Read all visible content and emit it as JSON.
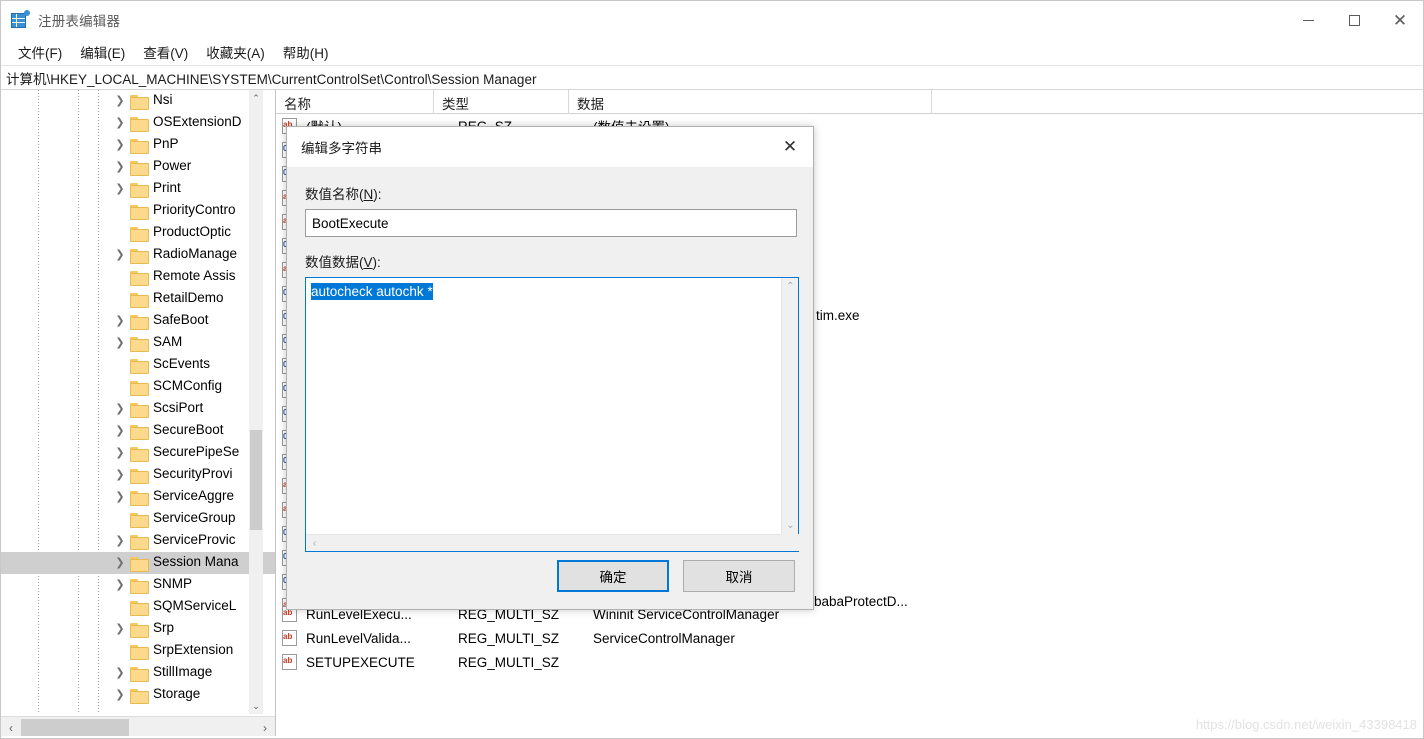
{
  "window": {
    "title": "注册表编辑器",
    "icon": "registry-editor-icon",
    "controls": {
      "minimize": "—",
      "maximize": "□",
      "close": "✕"
    }
  },
  "menubar": {
    "items": [
      {
        "label": "文件(F)",
        "name": "menu-file"
      },
      {
        "label": "编辑(E)",
        "name": "menu-edit"
      },
      {
        "label": "查看(V)",
        "name": "menu-view"
      },
      {
        "label": "收藏夹(A)",
        "name": "menu-favorites"
      },
      {
        "label": "帮助(H)",
        "name": "menu-help"
      }
    ]
  },
  "address": {
    "path": "计算机\\HKEY_LOCAL_MACHINE\\SYSTEM\\CurrentControlSet\\Control\\Session Manager"
  },
  "tree": {
    "items": [
      {
        "label": "Nsi",
        "expandable": true,
        "selected": false
      },
      {
        "label": "OSExtensionD",
        "expandable": true,
        "selected": false
      },
      {
        "label": "PnP",
        "expandable": true,
        "selected": false
      },
      {
        "label": "Power",
        "expandable": true,
        "selected": false
      },
      {
        "label": "Print",
        "expandable": true,
        "selected": false
      },
      {
        "label": "PriorityContro",
        "expandable": false,
        "selected": false
      },
      {
        "label": "ProductOptic",
        "expandable": false,
        "selected": false
      },
      {
        "label": "RadioManage",
        "expandable": true,
        "selected": false
      },
      {
        "label": "Remote Assis",
        "expandable": false,
        "selected": false
      },
      {
        "label": "RetailDemo",
        "expandable": false,
        "selected": false
      },
      {
        "label": "SafeBoot",
        "expandable": true,
        "selected": false
      },
      {
        "label": "SAM",
        "expandable": true,
        "selected": false
      },
      {
        "label": "ScEvents",
        "expandable": false,
        "selected": false
      },
      {
        "label": "SCMConfig",
        "expandable": false,
        "selected": false
      },
      {
        "label": "ScsiPort",
        "expandable": true,
        "selected": false
      },
      {
        "label": "SecureBoot",
        "expandable": true,
        "selected": false
      },
      {
        "label": "SecurePipeSe",
        "expandable": true,
        "selected": false
      },
      {
        "label": "SecurityProvi",
        "expandable": true,
        "selected": false
      },
      {
        "label": "ServiceAggre",
        "expandable": true,
        "selected": false
      },
      {
        "label": "ServiceGroup",
        "expandable": false,
        "selected": false
      },
      {
        "label": "ServiceProvic",
        "expandable": true,
        "selected": false
      },
      {
        "label": "Session Mana",
        "expandable": true,
        "selected": true
      },
      {
        "label": "SNMP",
        "expandable": true,
        "selected": false
      },
      {
        "label": "SQMServiceL",
        "expandable": false,
        "selected": false
      },
      {
        "label": "Srp",
        "expandable": true,
        "selected": false
      },
      {
        "label": "SrpExtension",
        "expandable": false,
        "selected": false
      },
      {
        "label": "StillImage",
        "expandable": true,
        "selected": false
      },
      {
        "label": "Storage",
        "expandable": true,
        "selected": false
      }
    ],
    "scroll_left_arrow": "‹",
    "scroll_right_arrow": "›",
    "scroll_up_arrow": "⌃",
    "scroll_down_arrow": "⌄"
  },
  "list": {
    "columns": [
      {
        "label": "名称",
        "name": "column-name"
      },
      {
        "label": "类型",
        "name": "column-type"
      },
      {
        "label": "数据",
        "name": "column-data"
      }
    ],
    "top_row": {
      "name": "(默认)",
      "type": "REG_SZ",
      "data": "(数值未设置)"
    },
    "fragments": [
      {
        "text": "tim.exe",
        "name": "row-data-fragment-tim-exe"
      },
      {
        "text": "babaProtectD...",
        "name": "row-data-fragment-babaprotect"
      }
    ],
    "rows": [
      {
        "icon": "string-value-icon",
        "name": "RunLevelExecu...",
        "type": "REG_MULTI_SZ",
        "data": "Wininit ServiceControlManager"
      },
      {
        "icon": "string-value-icon",
        "name": "RunLevelValida...",
        "type": "REG_MULTI_SZ",
        "data": "ServiceControlManager"
      },
      {
        "icon": "string-value-icon",
        "name": "SETUPEXECUTE",
        "type": "REG_MULTI_SZ",
        "data": ""
      }
    ]
  },
  "dialog": {
    "title": "编辑多字符串",
    "close_glyph": "✕",
    "value_name_label_pre": "数值名称(",
    "value_name_label_key": "N",
    "value_name_label_post": "):",
    "value_name": "BootExecute",
    "value_name_placeholder": "",
    "value_data_label_pre": "数值数据(",
    "value_data_label_key": "V",
    "value_data_label_post": "):",
    "value_data": "autocheck autochk *",
    "ok_label": "确定",
    "cancel_label": "取消",
    "scroll_up_arrow": "⌃",
    "scroll_down_arrow": "⌄",
    "scroll_left_arrow": "‹",
    "scroll_right_arrow": "›"
  },
  "watermark": {
    "text": "https://blog.csdn.net/weixin_43398418"
  },
  "colors": {
    "accent": "#0078d7",
    "selection": "#0078d7",
    "tree_selected": "#cfcfcf",
    "folder": "#fcd98b",
    "string_icon": "#c63a22",
    "binary_icon": "#1f5fb0"
  }
}
